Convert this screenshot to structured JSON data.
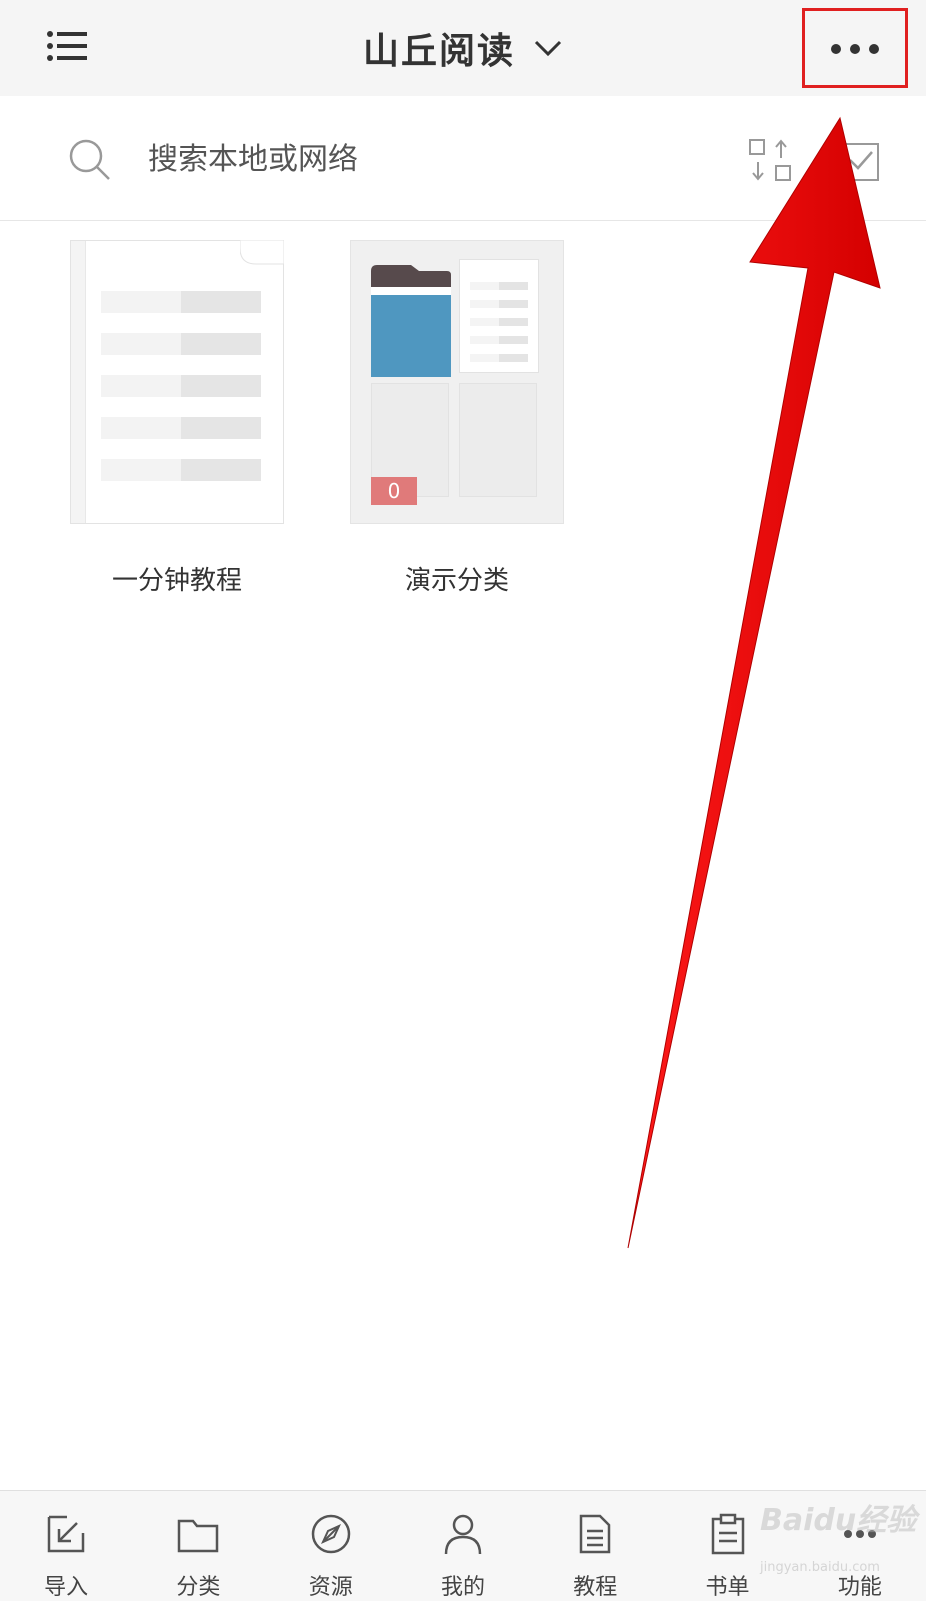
{
  "header": {
    "title": "山丘阅读",
    "menu_icon": "list-menu-icon",
    "dropdown_icon": "chevron-down-icon",
    "more_icon": "more-dots-icon"
  },
  "search": {
    "placeholder": "搜索本地或网络",
    "sort_icon": "sort-swap-icon",
    "select_icon": "checkbox-select-icon"
  },
  "shelf": {
    "items": [
      {
        "label": "一分钟教程",
        "type": "book"
      },
      {
        "label": "演示分类",
        "type": "category",
        "count": "0"
      }
    ]
  },
  "bottom_nav": {
    "items": [
      {
        "label": "导入",
        "icon": "import-icon"
      },
      {
        "label": "分类",
        "icon": "folder-icon"
      },
      {
        "label": "资源",
        "icon": "compass-icon"
      },
      {
        "label": "我的",
        "icon": "user-icon"
      },
      {
        "label": "教程",
        "icon": "document-icon"
      },
      {
        "label": "书单",
        "icon": "clipboard-icon"
      },
      {
        "label": "功能",
        "icon": "more-dots-icon"
      }
    ]
  },
  "watermark": {
    "logo": "Baidu经验",
    "sub": "jingyan.baidu.com"
  },
  "colors": {
    "highlight": "#e02020",
    "arrow": "#ff1a1a",
    "badge": "#e07a7a",
    "folder_blue": "#4f97c0"
  }
}
